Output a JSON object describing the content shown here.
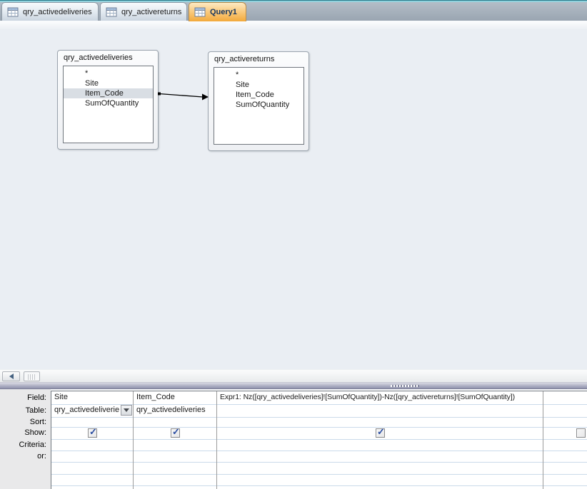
{
  "tabs": [
    {
      "label": "qry_activedeliveries",
      "active": false
    },
    {
      "label": "qry_activereturns",
      "active": false
    },
    {
      "label": "Query1",
      "active": true
    }
  ],
  "design": {
    "tables": [
      {
        "title": "qry_activedeliveries",
        "fields": [
          "*",
          "Site",
          "Item_Code",
          "SumOfQuantity"
        ],
        "selected_field": "Item_Code"
      },
      {
        "title": "qry_activereturns",
        "fields": [
          "*",
          "Site",
          "Item_Code",
          "SumOfQuantity"
        ],
        "selected_field": ""
      }
    ],
    "join": {
      "from": "qry_activedeliveries",
      "to": "qry_activereturns"
    }
  },
  "grid": {
    "row_labels": [
      "Field:",
      "Table:",
      "Sort:",
      "Show:",
      "Criteria:",
      "or:"
    ],
    "columns": [
      {
        "field": "Site",
        "table": "qry_activedeliverie",
        "sort": "",
        "show": true,
        "criteria": "",
        "or": ""
      },
      {
        "field": "Item_Code",
        "table": "qry_activedeliveries",
        "sort": "",
        "show": true,
        "criteria": "",
        "or": ""
      },
      {
        "field": "Expr1: Nz([qry_activedeliveries]![SumOfQuantity])-Nz([qry_activereturns]![SumOfQuantity])",
        "table": "",
        "sort": "",
        "show": true,
        "criteria": "",
        "or": ""
      },
      {
        "field": "",
        "table": "",
        "sort": "",
        "show": false,
        "criteria": "",
        "or": ""
      }
    ]
  },
  "icons": {
    "tab_icon": "query-datasheet-icon",
    "combo_arrow": "chevron-down",
    "scroll_left": "triangle-left",
    "check_glyph": "✓"
  },
  "colors": {
    "active_tab": "#F2A93B",
    "selection": "#D9DEE4",
    "splitter": "#9D9FB6",
    "grid_line_h": "#CBDAEA",
    "grid_line_v": "#9C9C9C",
    "check": "#2B4EA2"
  }
}
